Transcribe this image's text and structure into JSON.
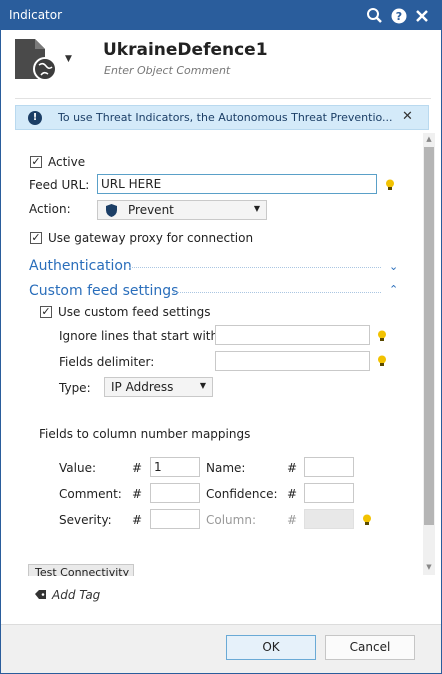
{
  "window": {
    "title": "Indicator"
  },
  "header": {
    "object_name": "UkraineDefence1",
    "comment_placeholder": "Enter Object Comment"
  },
  "banner": {
    "text": "To use Threat Indicators, the Autonomous Threat Preventio..."
  },
  "form": {
    "active_label": "Active",
    "feed_url_label": "Feed URL:",
    "feed_url_value": "URL HERE",
    "action_label": "Action:",
    "action_value": "Prevent",
    "proxy_label": "Use gateway proxy for connection"
  },
  "authentication": {
    "title": "Authentication"
  },
  "custom_feed": {
    "title": "Custom feed settings",
    "use_label": "Use custom feed settings",
    "ignore_label": "Ignore lines that start with:",
    "delimiter_label": "Fields delimiter:",
    "type_label": "Type:",
    "type_value": "IP Address",
    "mappings_title": "Fields to column number mappings",
    "hash": "#",
    "mappings": {
      "value_label": "Value:",
      "value_value": "1",
      "name_label": "Name:",
      "comment_label": "Comment:",
      "confidence_label": "Confidence:",
      "severity_label": "Severity:",
      "column_label": "Column:"
    }
  },
  "test_button": "Test Connectivity",
  "add_tag": "Add Tag",
  "footer": {
    "ok": "OK",
    "cancel": "Cancel"
  },
  "colors": {
    "titlebar": "#2a5d9c",
    "section": "#2a6ebb",
    "banner_bg": "#d4eaf9",
    "bulb": "#f2c200"
  }
}
